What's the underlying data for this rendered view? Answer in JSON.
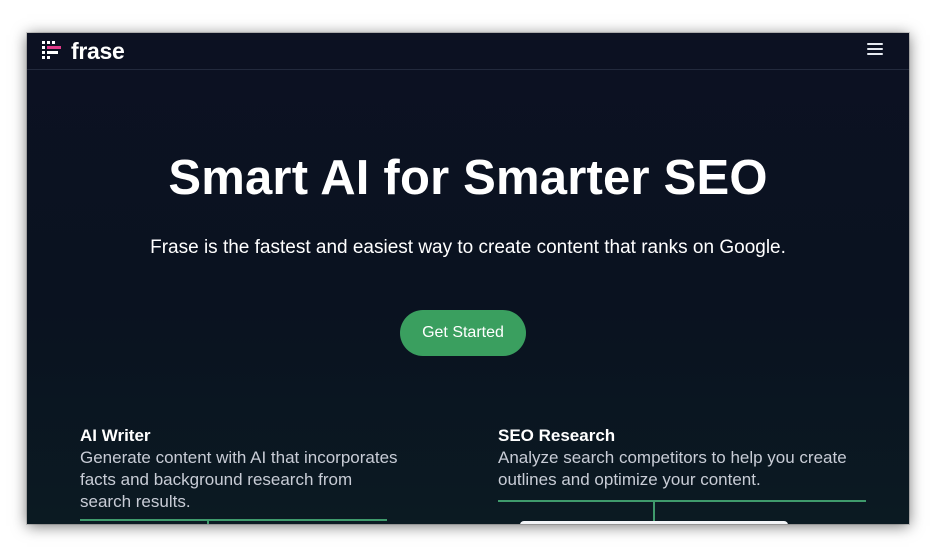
{
  "brand": {
    "name": "frase",
    "logo_icon": "frase-logo-icon"
  },
  "nav": {
    "menu_icon": "hamburger-menu-icon"
  },
  "hero": {
    "title": "Smart AI for Smarter SEO",
    "subtitle": "Frase is the fastest and easiest way to create content that ranks on Google.",
    "cta_label": "Get Started"
  },
  "features": [
    {
      "title": "AI Writer",
      "description": "Generate content with AI that incorporates facts and background research from search results."
    },
    {
      "title": "SEO Research",
      "description": "Analyze search competitors to help you create outlines and optimize your content."
    }
  ],
  "colors": {
    "background": "#0b1220",
    "accent_green": "#3a9f5f",
    "text_primary": "#ffffff",
    "text_secondary": "#c8ccd6"
  }
}
